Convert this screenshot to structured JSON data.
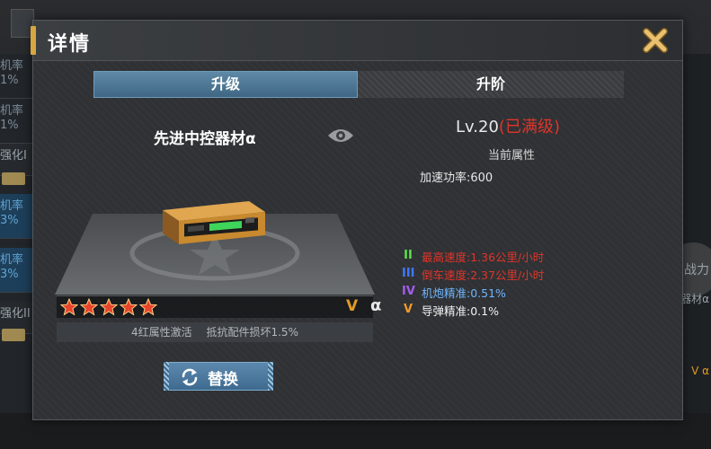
{
  "background": {
    "left_tabs": [
      "机率",
      "1%",
      "机率",
      "1%",
      "强化I",
      "机率",
      "3%",
      "机率",
      "3%",
      "强化II"
    ],
    "right_texts": [
      "战力",
      "器材α",
      "V α"
    ]
  },
  "dialog": {
    "title": "详情",
    "close_icon": "close-x-icon",
    "tabs": [
      {
        "label": "升级",
        "active": true
      },
      {
        "label": "升阶",
        "active": false
      }
    ]
  },
  "item": {
    "name": "先进中控器材α",
    "eye_icon": "eye-icon",
    "star_count": 5,
    "grade_tier": "V",
    "grade_symbol": "α",
    "set_bonus_label": "4红属性激活",
    "set_bonus_effect": "抵抗配件损坏1.5%",
    "replace_label": "替换"
  },
  "stats": {
    "level": "Lv.20",
    "level_status": "(已满级)",
    "current_attr_title": "当前属性",
    "main_attr": "加速功率:600",
    "sub_attrs": [
      {
        "tier": "II",
        "text": "最高速度:1.36公里/小时",
        "tier_color": "#5ee24a",
        "text_color": "#e0352a"
      },
      {
        "tier": "III",
        "text": "倒车速度:2.37公里/小时",
        "tier_color": "#3f78ff",
        "text_color": "#e0352a"
      },
      {
        "tier": "IV",
        "text": "机炮精准:0.51%",
        "tier_color": "#a45cf0",
        "text_color": "#6fb6ff"
      },
      {
        "tier": "V",
        "text": "导弹精准:0.1%",
        "tier_color": "#f09a28",
        "text_color": "#f2f2f2"
      }
    ]
  },
  "colors": {
    "accent_gold": "#d8a640",
    "max_level_red": "#e0352a",
    "tab_active_blue": "#4f7b9b"
  }
}
